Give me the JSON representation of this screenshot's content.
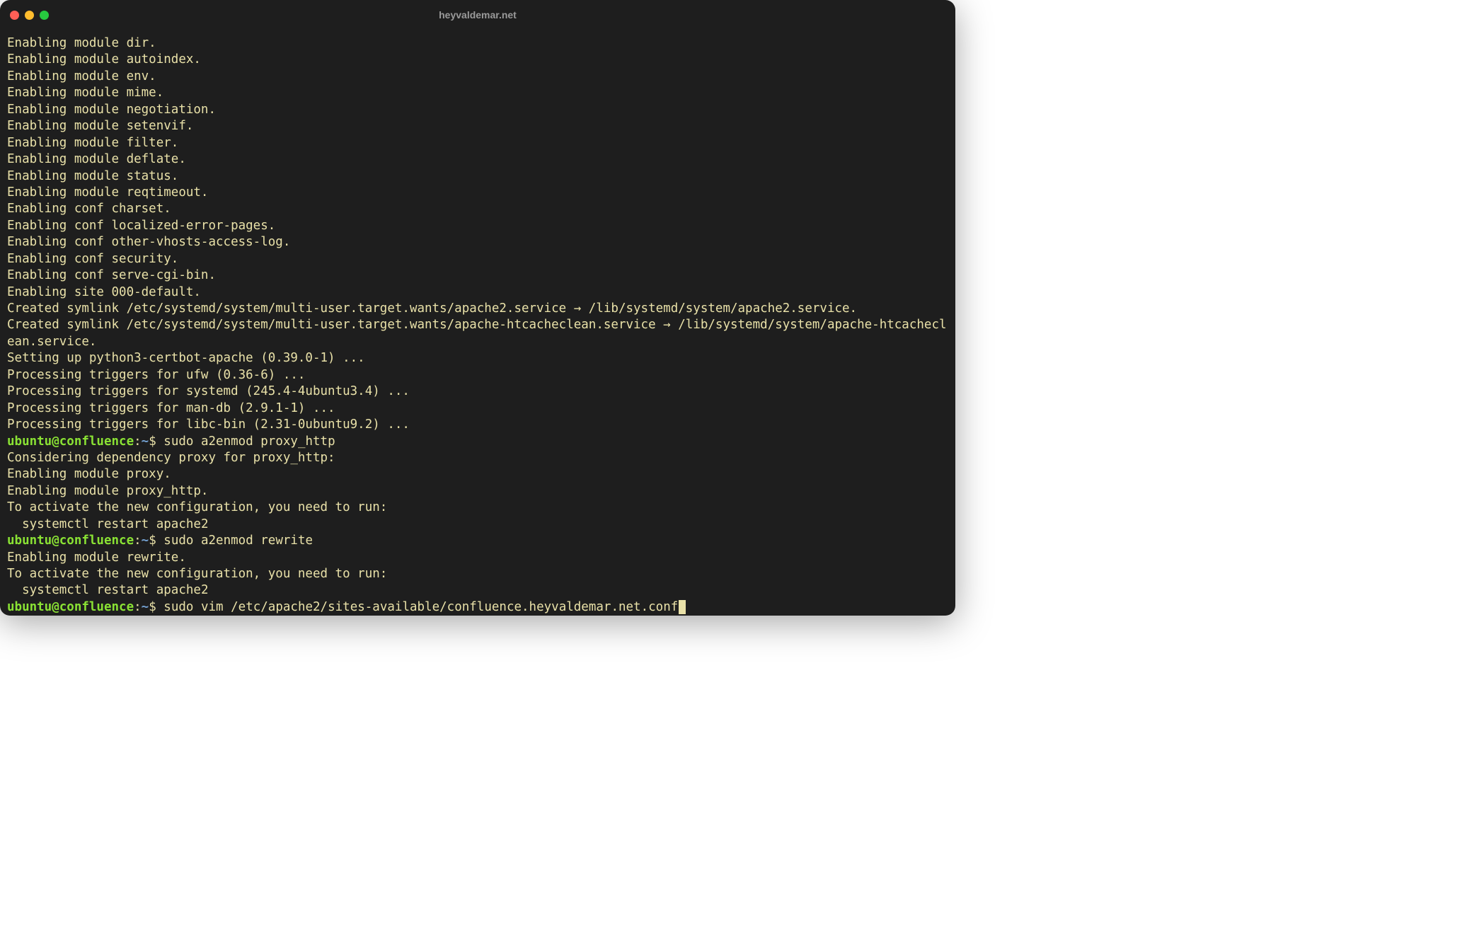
{
  "window": {
    "title": "heyvaldemar.net"
  },
  "output_blocks": [
    [
      "Enabling module dir.",
      "Enabling module autoindex.",
      "Enabling module env.",
      "Enabling module mime.",
      "Enabling module negotiation.",
      "Enabling module setenvif.",
      "Enabling module filter.",
      "Enabling module deflate.",
      "Enabling module status.",
      "Enabling module reqtimeout.",
      "Enabling conf charset.",
      "Enabling conf localized-error-pages.",
      "Enabling conf other-vhosts-access-log.",
      "Enabling conf security.",
      "Enabling conf serve-cgi-bin.",
      "Enabling site 000-default.",
      "Created symlink /etc/systemd/system/multi-user.target.wants/apache2.service → /lib/systemd/system/apache2.service.",
      "Created symlink /etc/systemd/system/multi-user.target.wants/apache-htcacheclean.service → /lib/systemd/system/apache-htcacheclean.service.",
      "Setting up python3-certbot-apache (0.39.0-1) ...",
      "Processing triggers for ufw (0.36-6) ...",
      "Processing triggers for systemd (245.4-4ubuntu3.4) ...",
      "Processing triggers for man-db (2.9.1-1) ...",
      "Processing triggers for libc-bin (2.31-0ubuntu9.2) ..."
    ],
    [
      "Considering dependency proxy for proxy_http:",
      "Enabling module proxy.",
      "Enabling module proxy_http.",
      "To activate the new configuration, you need to run:",
      "  systemctl restart apache2"
    ],
    [
      "Enabling module rewrite.",
      "To activate the new configuration, you need to run:",
      "  systemctl restart apache2"
    ]
  ],
  "prompts": [
    {
      "user_host": "ubuntu@confluence",
      "path": "~",
      "command": "sudo a2enmod proxy_http"
    },
    {
      "user_host": "ubuntu@confluence",
      "path": "~",
      "command": "sudo a2enmod rewrite"
    },
    {
      "user_host": "ubuntu@confluence",
      "path": "~",
      "command": "sudo vim /etc/apache2/sites-available/confluence.heyvaldemar.net.conf"
    }
  ],
  "colors": {
    "prompt_user": "#8ae234",
    "prompt_path": "#729fcf",
    "text": "#e9e1a8",
    "background": "#1e1e1e"
  }
}
